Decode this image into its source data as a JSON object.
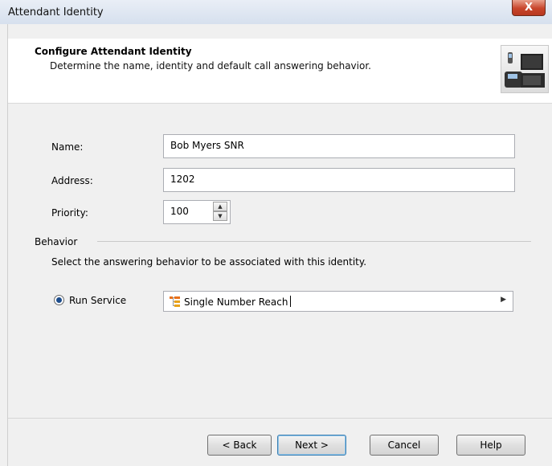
{
  "window": {
    "title": "Attendant Identity",
    "close_label": "X"
  },
  "header": {
    "title": "Configure Attendant Identity",
    "subtitle": "Determine the name, identity and default call answering behavior.",
    "graphic_icon": "phones-graphic-icon"
  },
  "form": {
    "name_label": "Name:",
    "name_value": "Bob Myers SNR",
    "address_label": "Address:",
    "address_value": "1202",
    "priority_label": "Priority:",
    "priority_value": "100"
  },
  "behavior": {
    "group_label": "Behavior",
    "description": "Select the answering behavior to be associated with this identity.",
    "radio_label": "Run Service",
    "radio_selected": true,
    "service_value": "Single Number Reach",
    "service_icon": "tree-service-icon"
  },
  "buttons": {
    "back": "< Back",
    "next": "Next >",
    "cancel": "Cancel",
    "help": "Help"
  },
  "colors": {
    "accent": "#3c7fb1",
    "close": "#c8452b"
  }
}
